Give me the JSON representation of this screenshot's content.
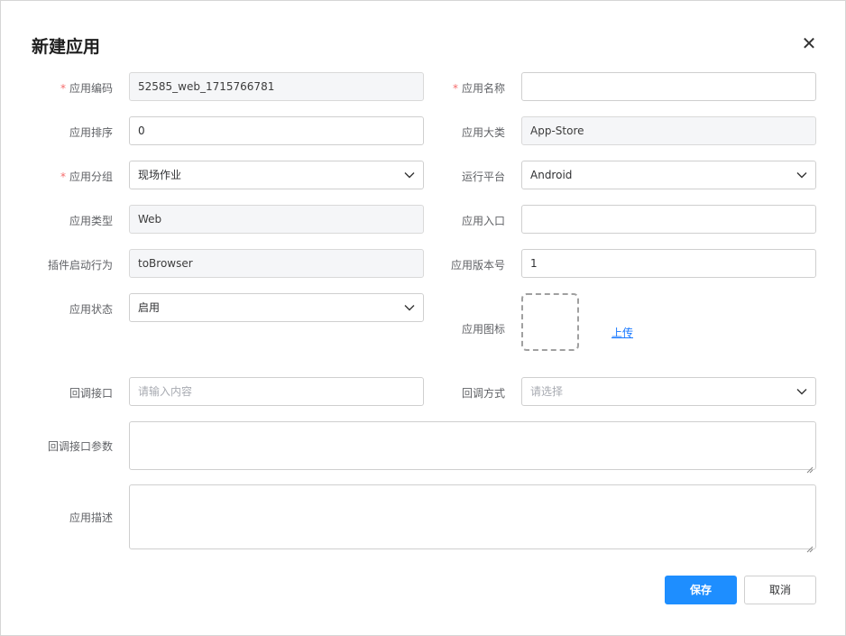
{
  "dialog": {
    "title": "新建应用",
    "close_icon": "close-icon"
  },
  "form": {
    "app_code": {
      "label": "应用编码",
      "value": "52585_web_1715766781",
      "required": true
    },
    "app_name": {
      "label": "应用名称",
      "value": "",
      "required": true
    },
    "app_sort": {
      "label": "应用排序",
      "value": "0"
    },
    "app_category": {
      "label": "应用大类",
      "value": "App-Store"
    },
    "app_group": {
      "label": "应用分组",
      "value": "现场作业",
      "required": true
    },
    "run_platform": {
      "label": "运行平台",
      "value": "Android"
    },
    "app_type": {
      "label": "应用类型",
      "value": "Web"
    },
    "app_entry": {
      "label": "应用入口",
      "value": ""
    },
    "plugin_behavior": {
      "label": "插件启动行为",
      "value": "toBrowser"
    },
    "app_version": {
      "label": "应用版本号",
      "value": "1"
    },
    "app_status": {
      "label": "应用状态",
      "value": "启用"
    },
    "app_icon": {
      "label": "应用图标",
      "upload_label": "上传"
    },
    "callback_api": {
      "label": "回调接口",
      "placeholder": "请输入内容"
    },
    "callback_method": {
      "label": "回调方式",
      "placeholder": "请选择"
    },
    "callback_params": {
      "label": "回调接口参数",
      "value": ""
    },
    "app_desc": {
      "label": "应用描述",
      "value": ""
    }
  },
  "buttons": {
    "save": "保存",
    "cancel": "取消"
  },
  "colors": {
    "primary": "#1e8eff",
    "required": "#f56c6c",
    "link": "#1677ff"
  }
}
